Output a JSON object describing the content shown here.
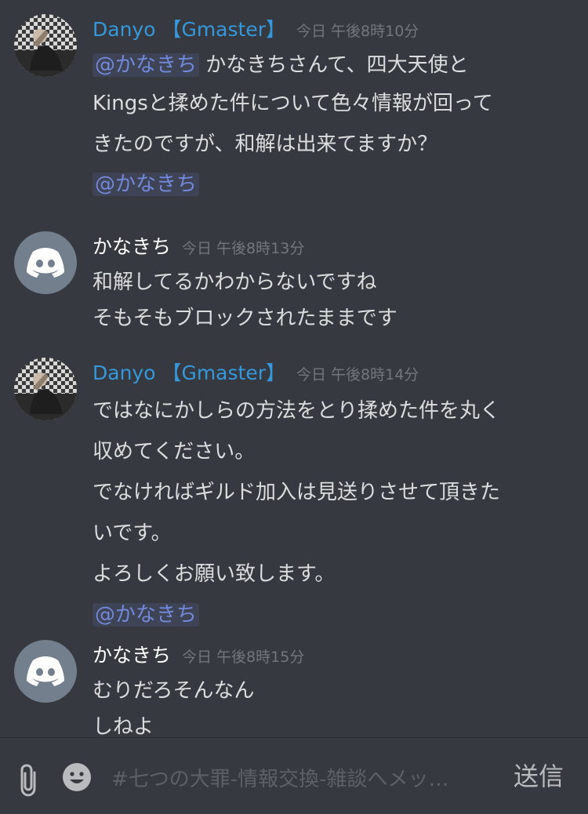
{
  "messages": [
    {
      "author": "Danyo 【Gmaster】",
      "time": "今日 午後8時10分",
      "mention_top": "@かなきち",
      "line1": " かなきちさんて、四大天使と",
      "line2": "Kingsと揉めた件について色々情報が回って",
      "line3": "きたのですが、和解は出来てますか？",
      "mention_bottom": "@かなきち"
    },
    {
      "author": "かなきち",
      "time": "今日 午後8時13分",
      "line1": "和解してるかわからないですね",
      "line2": "そもそもブロックされたままです"
    },
    {
      "author": "Danyo 【Gmaster】",
      "time": "今日 午後8時14分",
      "line1": "ではなにかしらの方法をとり揉めた件を丸く",
      "line2": "収めてください。",
      "line3": "でなければギルド加入は見送りさせて頂きた",
      "line4": "いです。",
      "line5": "よろしくお願い致します。",
      "mention_bottom": "@かなきち"
    },
    {
      "author": "かなきち",
      "time": "今日 午後8時15分",
      "line1": "むりだろそんなん",
      "line2": "しねよ"
    }
  ],
  "composer": {
    "placeholder": "#七つの大罪-情報交換-雑談へメッ…",
    "send_label": "送信",
    "attach_icon": "paperclip-icon",
    "emoji_icon": "smiley-icon"
  },
  "colors": {
    "background": "#36393f",
    "role_color": "#3498db",
    "mention": "#7289da",
    "timestamp": "#72767d"
  }
}
